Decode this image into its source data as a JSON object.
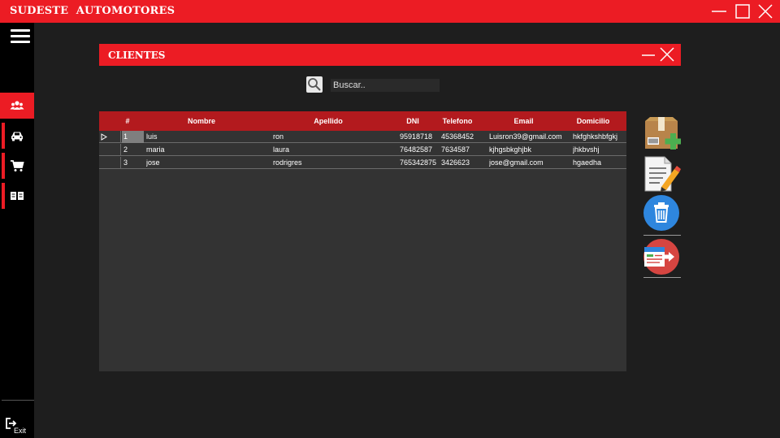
{
  "app": {
    "title": "SUDESTE  AUTOMOTORES"
  },
  "sidebar": {
    "items": [
      {
        "name": "clientes",
        "icon": "users-icon",
        "active": true
      },
      {
        "name": "vehiculos",
        "icon": "car-icon",
        "active": false
      },
      {
        "name": "ventas",
        "icon": "cart-icon",
        "active": false
      },
      {
        "name": "registros",
        "icon": "book-icon",
        "active": false
      }
    ],
    "exit_label": "Exit"
  },
  "panel": {
    "title": "CLIENTES",
    "search_placeholder": "Buscar.."
  },
  "table": {
    "columns": [
      "#",
      "Nombre",
      "Apellido",
      "DNI",
      "Telefono",
      "Email",
      "Domicilio"
    ],
    "rows": [
      {
        "id": "1",
        "nombre": "luis",
        "apellido": "ron",
        "dni": "95918718",
        "telefono": "45368452",
        "email": "Luisron39@gmail.com",
        "domicilio": "hkfghkshbfgkj"
      },
      {
        "id": "2",
        "nombre": "maria",
        "apellido": "laura",
        "dni": "76482587",
        "telefono": "7634587",
        "email": "kjhgsbkghjbk",
        "domicilio": "jhkbvshj"
      },
      {
        "id": "3",
        "nombre": "jose",
        "apellido": "rodrigres",
        "dni": "765342875",
        "telefono": "3426623",
        "email": "jose@gmail.com",
        "domicilio": "hgaedha"
      }
    ]
  },
  "actions": [
    {
      "name": "add-client",
      "icon": "box-add-icon"
    },
    {
      "name": "edit-client",
      "icon": "document-edit-icon"
    },
    {
      "name": "delete-client",
      "icon": "trash-icon"
    },
    {
      "name": "export-client",
      "icon": "export-icon"
    }
  ],
  "colors": {
    "accent": "#ec1c24",
    "header": "#b31a1e",
    "background": "#1e1e1e",
    "sidebar": "#000000",
    "grid": "#333333"
  }
}
